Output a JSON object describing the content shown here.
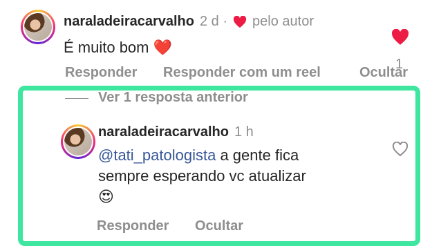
{
  "comment1": {
    "username": "naraladeiracarvalho",
    "time": "2 d ·",
    "author_like_label": "pelo autor",
    "text": "É muito bom",
    "emoji": "❤️",
    "like_count": "1",
    "actions": [
      "Responder",
      "Responder com um reel",
      "Ocultar"
    ]
  },
  "view_previous": "Ver 1 resposta anterior",
  "reply": {
    "username": "naraladeiracarvalho",
    "time": "1 h",
    "mention": "@tati_patologista",
    "text_line1": " a gente fica",
    "text_line2": "sempre esperando vc atualizar",
    "emoji": "😍",
    "actions": [
      "Responder",
      "Ocultar"
    ]
  },
  "colors": {
    "highlight": "#3ee6a0",
    "heart": "#ed1c45",
    "mention": "#385898"
  }
}
